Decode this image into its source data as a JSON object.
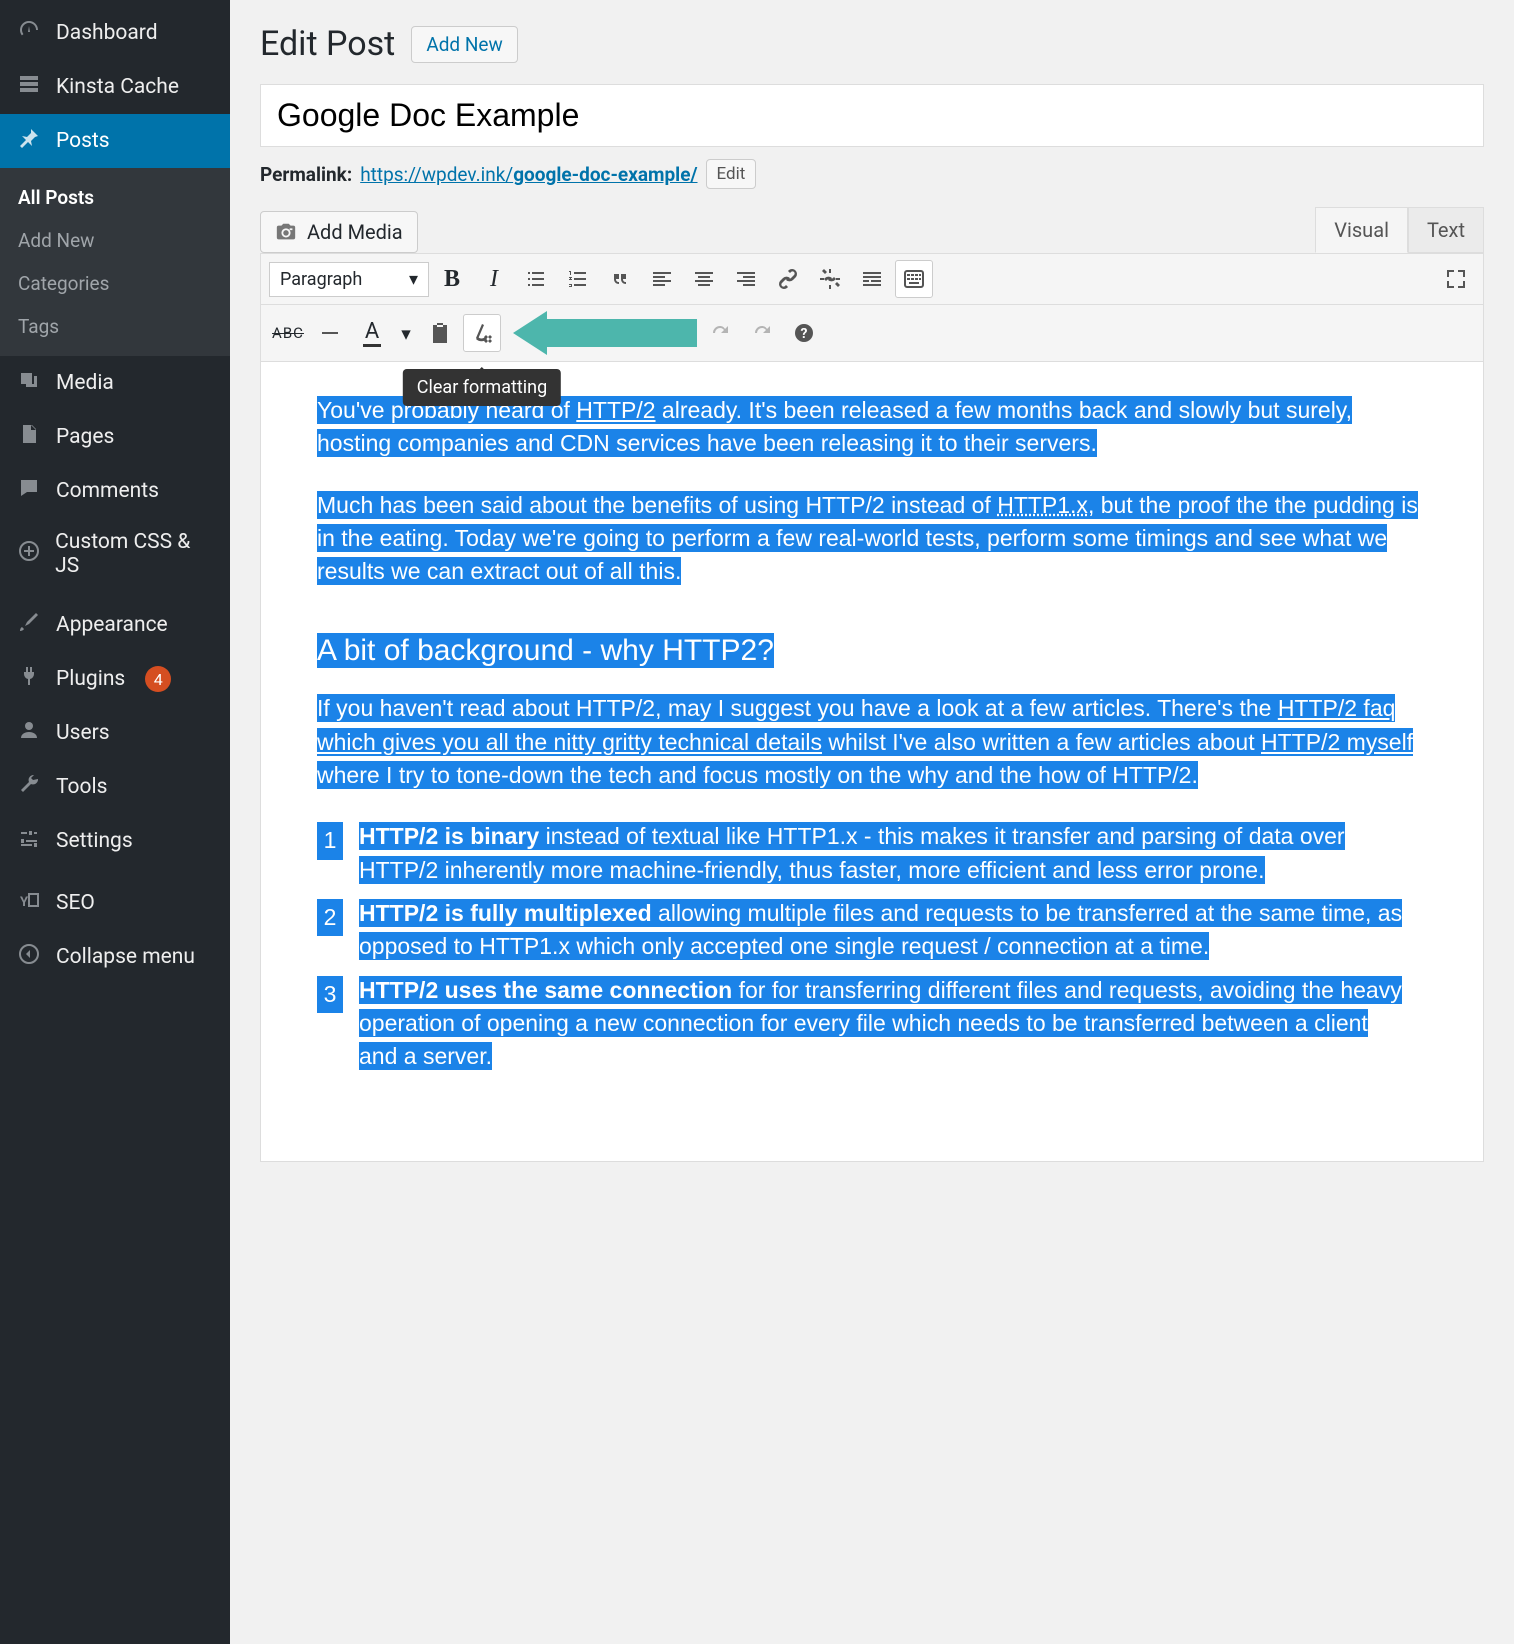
{
  "sidebar": {
    "items": [
      {
        "icon": "dashboard",
        "label": "Dashboard"
      },
      {
        "icon": "kinsta",
        "label": "Kinsta Cache"
      },
      {
        "icon": "pin",
        "label": "Posts",
        "active": true,
        "submenu": [
          {
            "label": "All Posts",
            "current": true
          },
          {
            "label": "Add New"
          },
          {
            "label": "Categories"
          },
          {
            "label": "Tags"
          }
        ]
      },
      {
        "icon": "media",
        "label": "Media"
      },
      {
        "icon": "page",
        "label": "Pages"
      },
      {
        "icon": "comment",
        "label": "Comments"
      },
      {
        "icon": "plus",
        "label": "Custom CSS & JS"
      },
      {
        "sep": true
      },
      {
        "icon": "brush",
        "label": "Appearance"
      },
      {
        "icon": "plugin",
        "label": "Plugins",
        "badge": "4"
      },
      {
        "icon": "user",
        "label": "Users"
      },
      {
        "icon": "wrench",
        "label": "Tools"
      },
      {
        "icon": "sliders",
        "label": "Settings"
      },
      {
        "sep": true
      },
      {
        "icon": "seo",
        "label": "SEO"
      },
      {
        "icon": "collapse",
        "label": "Collapse menu"
      }
    ]
  },
  "header": {
    "title": "Edit Post",
    "add_new": "Add New"
  },
  "post": {
    "title": "Google Doc Example",
    "permalink_label": "Permalink:",
    "permalink_base": "https://wpdev.ink/",
    "permalink_slug": "google-doc-example/",
    "edit": "Edit"
  },
  "editor_ui": {
    "add_media": "Add Media",
    "tabs": {
      "visual": "Visual",
      "text": "Text"
    },
    "format": "Paragraph",
    "tooltip": "Clear formatting"
  },
  "content": {
    "p1_a": "You've probably heard of ",
    "p1_link": "HTTP/2",
    "p1_b": " already. It's been released a few months back and slowly but surely, hosting companies and CDN services have been releasing it to their servers.",
    "p2_a": "Much has been said about the benefits of using HTTP/2 instead of ",
    "p2_link": "HTTP1.x",
    "p2_b": ", but the proof the the pudding is in the eating. Today we're going to perform a few real-world tests, perform some timings and see what we results we can extract out of all this.",
    "h2": "A bit of background - why HTTP2?",
    "p3_a": "If you haven't read about HTTP/2, may I suggest you have a look at a few articles. There's the ",
    "p3_link1": "HTTP/2 faq which gives you all the nitty gritty technical details",
    "p3_b": " whilst I've also written a few articles about ",
    "p3_link2": "HTTP/2 myself",
    "p3_c": " where I try to tone-down the tech and focus mostly on the why and the how of HTTP/2.",
    "li1_b": "HTTP/2 is binary",
    "li1": " instead of textual like HTTP1.x - this makes it transfer and parsing of data over HTTP/2 inherently more machine-friendly, thus faster, more efficient and less error prone.",
    "li2_b": "HTTP/2 is fully multiplexed",
    "li2": " allowing multiple files and requests to be transferred at the same time, as opposed to HTTP1.x which only accepted one single request / connection at a time.",
    "li3_b": " HTTP/2 uses the same connection",
    "li3": " for for transferring different files and requests, avoiding the heavy operation of opening a new connection for every file which needs to be transferred between a client and a server."
  }
}
